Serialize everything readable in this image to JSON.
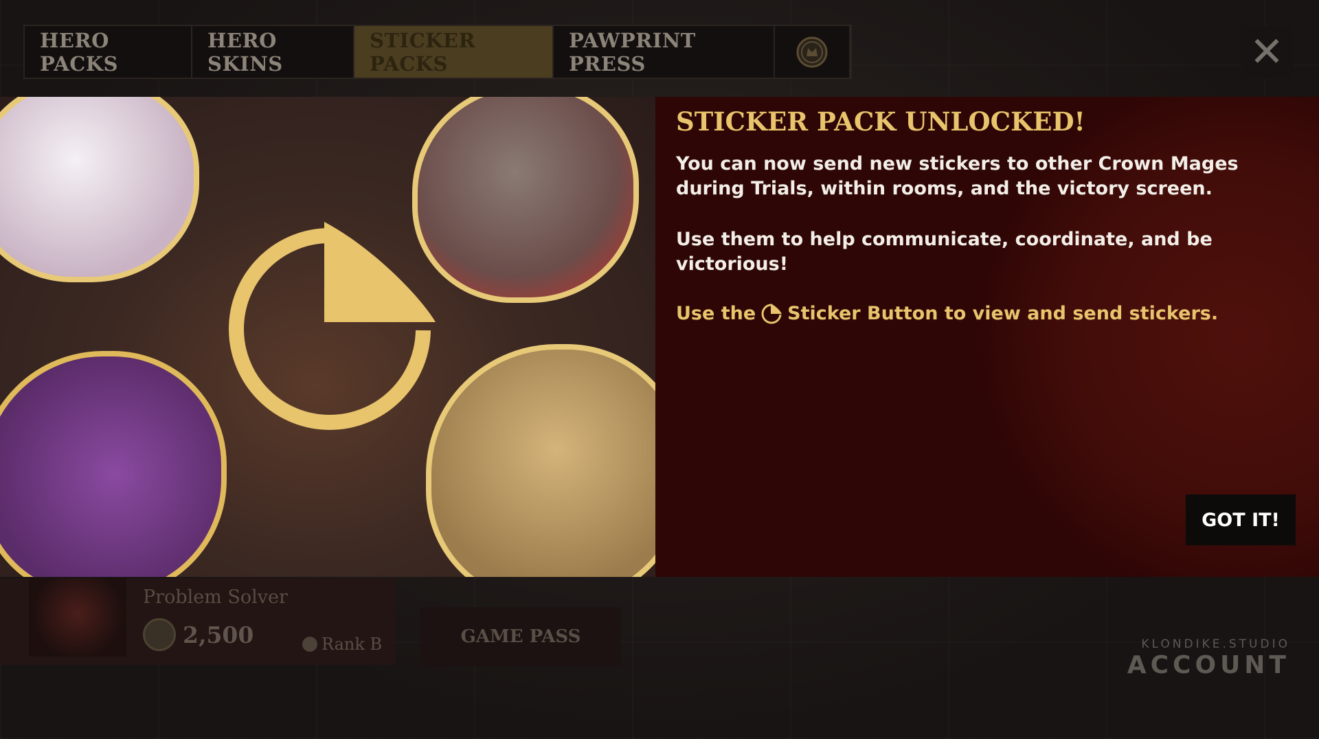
{
  "tabs": [
    {
      "label": "HERO PACKS",
      "active": false
    },
    {
      "label": "HERO SKINS",
      "active": false
    },
    {
      "label": "STICKER PACKS",
      "active": true
    },
    {
      "label": "PAWPRINT PRESS",
      "active": false
    }
  ],
  "coin_tab_icon": "crown-coin-icon",
  "close_icon": "close-icon",
  "modal": {
    "title": "STICKER PACK UNLOCKED!",
    "paragraph1": "You can now send new stickers to other Crown Mages during Trials, within rooms, and the victory screen.",
    "paragraph2": "Use them to help communicate, coordinate, and be victorious!",
    "hint_prefix": "Use the",
    "hint_icon": "sticker-button-icon",
    "hint_suffix": "Sticker Button to view and send stickers.",
    "button_label": "GOT IT!"
  },
  "profile": {
    "name": "Problem Solver",
    "coins": "2,500",
    "rank": "Rank B"
  },
  "game_pass_label": "GAME PASS",
  "studio": {
    "small": "KLONDIKE.STUDIO",
    "big": "ACCOUNT"
  },
  "colors": {
    "accent_gold": "#e8c46c",
    "panel_red": "#2e0605",
    "tab_active": "#4b3d20"
  }
}
